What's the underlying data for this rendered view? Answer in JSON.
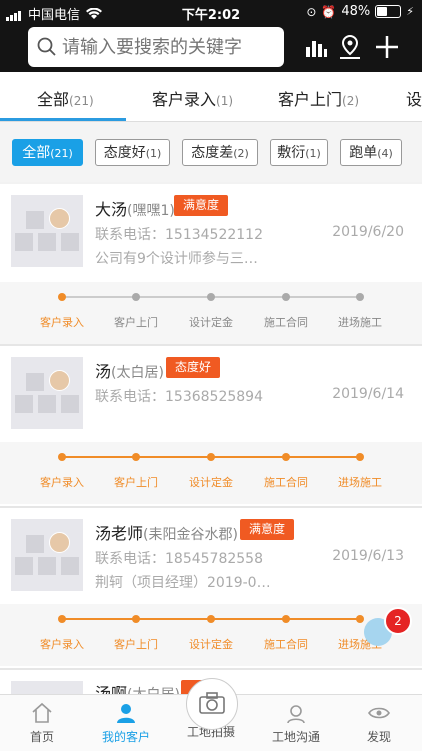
{
  "status_bar": {
    "carrier": "中国电信",
    "time": "下午2:02",
    "battery": "48%"
  },
  "search": {
    "placeholder": "请输入要搜索的关键字"
  },
  "header_icons": [
    "bar-chart-icon",
    "map-pin-icon",
    "plus-icon"
  ],
  "tabs": [
    {
      "label": "全部",
      "count": "(21)"
    },
    {
      "label": "客户录入",
      "count": "(1)"
    },
    {
      "label": "客户上门",
      "count": "(2)"
    },
    {
      "label": "设",
      "count": ""
    }
  ],
  "filters": [
    {
      "label": "全部",
      "count": "(21)"
    },
    {
      "label": "态度好",
      "count": "(1)"
    },
    {
      "label": "态度差",
      "count": "(2)"
    },
    {
      "label": "敷衍",
      "count": "(1)"
    },
    {
      "label": "跑单",
      "count": "(4)"
    }
  ],
  "customers": [
    {
      "name": "大汤",
      "alias": "(嘿嘿1)",
      "badge": "满意度",
      "phone": "联系电话：15134522112",
      "date": "2019/6/20",
      "note": "公司有9个设计师参与三…",
      "progress_done": 1
    },
    {
      "name": "汤",
      "alias": "(太白居)",
      "badge": "态度好",
      "phone": "联系电话：15368525894",
      "date": "2019/6/14",
      "note": "",
      "progress_done": 5
    },
    {
      "name": "汤老师",
      "alias": "(耒阳金谷水郡)",
      "badge": "满意度",
      "phone": "联系电话：18545782558",
      "date": "2019/6/13",
      "note": "荆轲（项目经理）2019-0…",
      "progress_done": 5
    },
    {
      "name": "汤啊",
      "alias": "(太白居)",
      "badge": "",
      "phone": "",
      "date": "",
      "note": "",
      "progress_done": 0
    }
  ],
  "progress_steps": [
    "客户录入",
    "客户上门",
    "设计定金",
    "施工合同",
    "进场施工"
  ],
  "fab_badge": "2",
  "bottom_nav": [
    {
      "label": "首页",
      "icon": "home-icon"
    },
    {
      "label": "我的客户",
      "icon": "person-icon"
    },
    {
      "label": "工地拍摄",
      "icon": "camera-icon"
    },
    {
      "label": "工地沟通",
      "icon": "headset-icon"
    },
    {
      "label": "发现",
      "icon": "eye-icon"
    }
  ],
  "colors": {
    "accent": "#1aa0e6",
    "orange": "#f08c28",
    "badge": "#f05a22"
  }
}
